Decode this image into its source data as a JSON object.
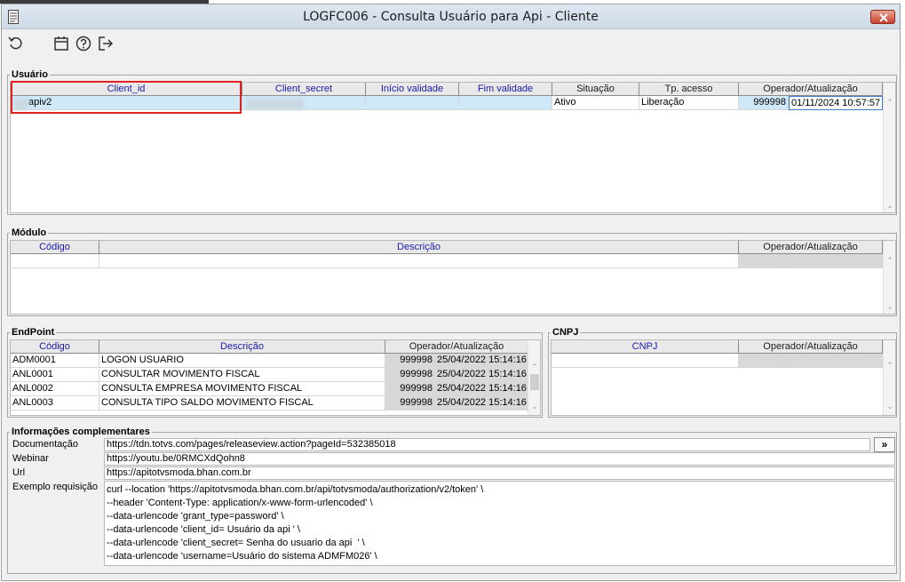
{
  "window": {
    "title": "LOGFC006 - Consulta Usuário para Api - Cliente"
  },
  "toolbar": {
    "icons": [
      "refresh-icon",
      "calendar-icon",
      "help-icon",
      "exit-icon"
    ]
  },
  "usuario": {
    "title": "Usuário",
    "columns": [
      "Client_id",
      "Client_secret",
      "Início validade",
      "Fim validade",
      "Situação",
      "Tp. acesso",
      "Operador/Atualização"
    ],
    "row": {
      "client_id": "apiv2",
      "client_secret": "",
      "inicio": "",
      "fim": "",
      "situacao": "Ativo",
      "tp_acesso": "Liberação",
      "operador": "999998",
      "atualizacao": "01/11/2024 10:57:57"
    }
  },
  "modulo": {
    "title": "Módulo",
    "columns": [
      "Código",
      "Descrição",
      "Operador/Atualização"
    ]
  },
  "endpoint": {
    "title": "EndPoint",
    "columns": [
      "Código",
      "Descrição",
      "Operador/Atualização"
    ],
    "rows": [
      {
        "codigo": "ADM0001",
        "descricao": "LOGON USUARIO",
        "operador": "999998",
        "data": "25/04/2022 15:14:16"
      },
      {
        "codigo": "ANL0001",
        "descricao": "CONSULTAR MOVIMENTO FISCAL",
        "operador": "999998",
        "data": "25/04/2022 15:14:16"
      },
      {
        "codigo": "ANL0002",
        "descricao": "CONSULTA EMPRESA MOVIMENTO FISCAL",
        "operador": "999998",
        "data": "25/04/2022 15:14:16"
      },
      {
        "codigo": "ANL0003",
        "descricao": "CONSULTA TIPO SALDO MOVIMENTO FISCAL",
        "operador": "999998",
        "data": "25/04/2022 15:14:16"
      }
    ]
  },
  "cnpj": {
    "title": "CNPJ",
    "columns": [
      "CNPJ",
      "Operador/Atualização"
    ]
  },
  "info": {
    "title": "Informações complementares",
    "documentacao_label": "Documentação",
    "documentacao_value": "https://tdn.totvs.com/pages/releaseview.action?pageId=532385018",
    "more_label": "»",
    "webinar_label": "Webinar",
    "webinar_value": "https://youtu.be/0RMCXdQohn8",
    "url_label": "Url",
    "url_value": "https://apitotvsmoda.bhan.com.br",
    "exemplo_label": "Exemplo requisição",
    "exemplo_lines": [
      "curl --location 'https://apitotvsmoda.bhan.com.br/api/totvsmoda/authorization/v2/token' \\",
      "--header 'Content-Type: application/x-www-form-urlencoded' \\",
      "--data-urlencode 'grant_type=password' \\",
      "--data-urlencode 'client_id= Usuário da api ' \\",
      "--data-urlencode 'client_secret= Senha do usuario da api  ' \\",
      "--data-urlencode 'username=Usuário do sistema ADMFM026' \\"
    ]
  },
  "colors": {
    "header_text": "#1a1aa8",
    "selection": "#cfe9f9",
    "highlight_box": "#e02020",
    "close_button": "#c7442e"
  }
}
